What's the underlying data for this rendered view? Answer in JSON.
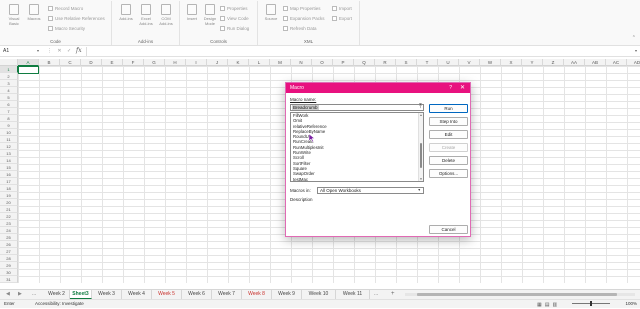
{
  "ribbon": {
    "code_group": {
      "label": "Code",
      "visual_basic": "Visual Basic",
      "macros": "Macros",
      "record_macro": "Record Macro",
      "use_relative": "Use Relative References",
      "macro_security": "Macro Security"
    },
    "addins_group": {
      "label": "Add-ins",
      "add_ins": "Add-ins",
      "excel_add_ins": "Excel Add-ins",
      "com_add_ins": "COM Add-ins"
    },
    "controls_group": {
      "label": "Controls",
      "insert": "Insert",
      "design_mode": "Design Mode",
      "properties": "Properties",
      "view_code": "View Code",
      "run_dialog": "Run Dialog"
    },
    "xml_group": {
      "label": "XML",
      "source": "Source",
      "map_properties": "Map Properties",
      "expansion_packs": "Expansion Packs",
      "refresh_data": "Refresh Data",
      "import": "Import",
      "export": "Export"
    }
  },
  "formula_bar": {
    "name_box": "A1",
    "fx": "fx",
    "formula": ""
  },
  "grid": {
    "columns": [
      "A",
      "B",
      "C",
      "D",
      "E",
      "F",
      "G",
      "H",
      "I",
      "J",
      "K",
      "L",
      "M",
      "N",
      "O",
      "P",
      "Q",
      "R",
      "S",
      "T",
      "U",
      "V",
      "W",
      "X",
      "Y",
      "Z",
      "AA",
      "AB",
      "AC",
      "AD"
    ],
    "rows": [
      "1",
      "2",
      "3",
      "4",
      "5",
      "6",
      "7",
      "8",
      "9",
      "10",
      "11",
      "12",
      "13",
      "14",
      "15",
      "16",
      "17",
      "18",
      "19",
      "20",
      "21",
      "22",
      "23",
      "24",
      "25",
      "26",
      "27",
      "28",
      "29",
      "30",
      "31"
    ],
    "active_cell": "A1"
  },
  "macro_dialog": {
    "title": "Macro",
    "help": "?",
    "close": "✕",
    "macro_name_label": "Macro name:",
    "macro_name_value": "Breadcrumb",
    "macro_list": [
      "FillWork",
      "Omit",
      "relativeReference",
      "ReplaceByName",
      "RoundUp",
      "RunCreate",
      "RunMultiplesInit",
      "RunWrite",
      "Scroll",
      "SortFilter",
      "Square",
      "SwapOrder",
      "testMac"
    ],
    "buttons": {
      "run": "Run",
      "step_into": "Step Into",
      "edit": "Edit",
      "create": "Create",
      "delete": "Delete",
      "options": "Options...",
      "cancel": "Cancel"
    },
    "macros_in_label": "Macros in:",
    "macros_in_value": "All Open Workbooks",
    "description_label": "Description"
  },
  "sheet_tabs": {
    "more_left": "...",
    "tabs": [
      {
        "label": "Week 2",
        "state": "normal"
      },
      {
        "label": "Sheet3",
        "state": "active"
      },
      {
        "label": "Week 3",
        "state": "normal"
      },
      {
        "label": "Week 4",
        "state": "normal"
      },
      {
        "label": "Week 5",
        "state": "red"
      },
      {
        "label": "Week 6",
        "state": "normal"
      },
      {
        "label": "Week 7",
        "state": "normal"
      },
      {
        "label": "Week 8",
        "state": "red"
      },
      {
        "label": "Week 9",
        "state": "normal"
      },
      {
        "label": "Week 10",
        "state": "normal"
      },
      {
        "label": "Week 11",
        "state": "normal"
      }
    ],
    "more_right": "...",
    "add": "+"
  },
  "status_bar": {
    "ready": "Enter",
    "accessibility": "Accessibility: Investigate",
    "zoom": "100%"
  },
  "colors": {
    "dialog_title": "#e8117f",
    "excel_green": "#107c41",
    "tab_red": "#c9302c"
  }
}
